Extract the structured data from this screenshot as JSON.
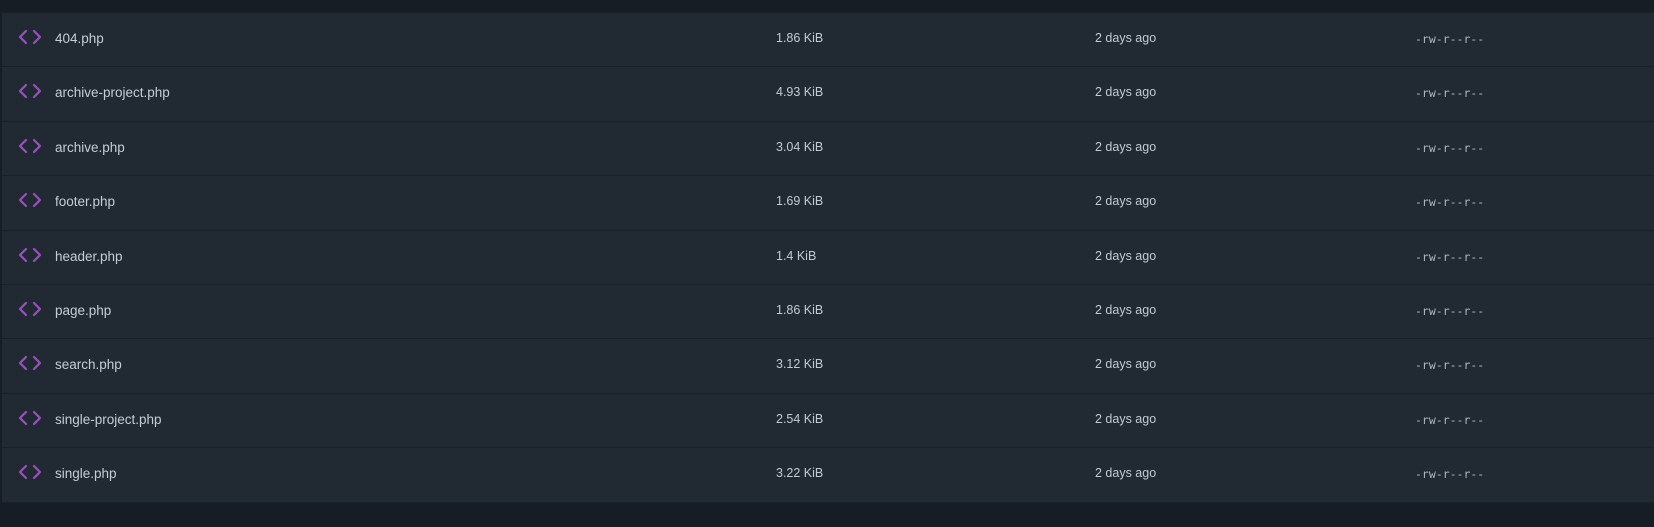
{
  "theme": {
    "icon_color": "#9b4fbf",
    "row_background": "#212a33",
    "page_background": "#161d25",
    "text_color": "#c5ccd4"
  },
  "files": [
    {
      "icon": "code-icon",
      "name": "404.php",
      "size": "1.86 KiB",
      "modified": "2 days ago",
      "permissions": "-rw-r--r--"
    },
    {
      "icon": "code-icon",
      "name": "archive-project.php",
      "size": "4.93 KiB",
      "modified": "2 days ago",
      "permissions": "-rw-r--r--"
    },
    {
      "icon": "code-icon",
      "name": "archive.php",
      "size": "3.04 KiB",
      "modified": "2 days ago",
      "permissions": "-rw-r--r--"
    },
    {
      "icon": "code-icon",
      "name": "footer.php",
      "size": "1.69 KiB",
      "modified": "2 days ago",
      "permissions": "-rw-r--r--"
    },
    {
      "icon": "code-icon",
      "name": "header.php",
      "size": "1.4 KiB",
      "modified": "2 days ago",
      "permissions": "-rw-r--r--"
    },
    {
      "icon": "code-icon",
      "name": "page.php",
      "size": "1.86 KiB",
      "modified": "2 days ago",
      "permissions": "-rw-r--r--"
    },
    {
      "icon": "code-icon",
      "name": "search.php",
      "size": "3.12 KiB",
      "modified": "2 days ago",
      "permissions": "-rw-r--r--"
    },
    {
      "icon": "code-icon",
      "name": "single-project.php",
      "size": "2.54 KiB",
      "modified": "2 days ago",
      "permissions": "-rw-r--r--"
    },
    {
      "icon": "code-icon",
      "name": "single.php",
      "size": "3.22 KiB",
      "modified": "2 days ago",
      "permissions": "-rw-r--r--"
    }
  ]
}
